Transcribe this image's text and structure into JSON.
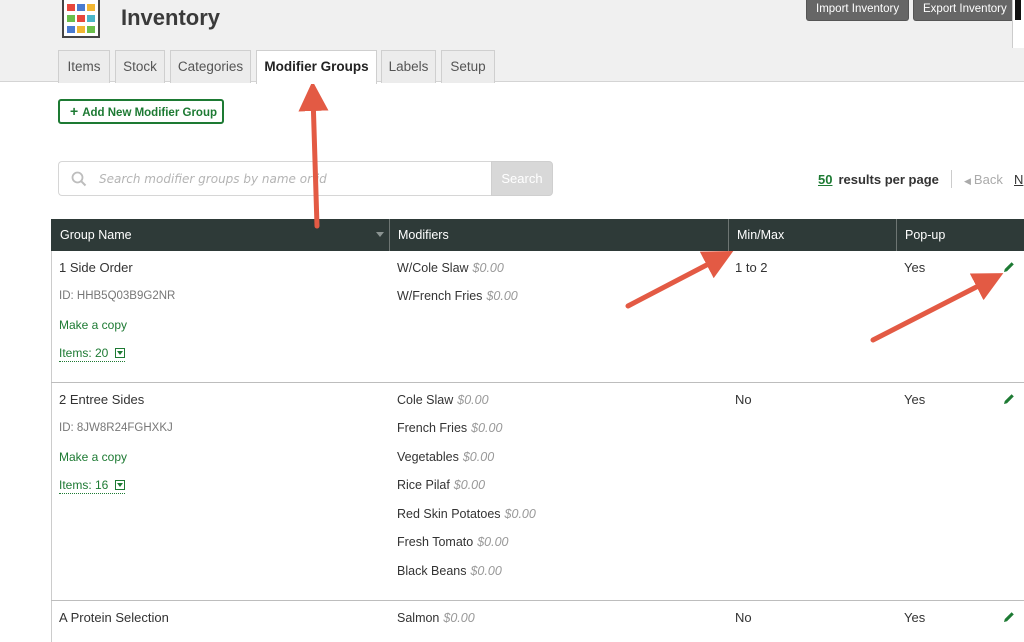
{
  "header": {
    "title": "Inventory",
    "import_label": "Import Inventory",
    "export_label": "Export Inventory"
  },
  "tabs": [
    {
      "label": "Items",
      "active": false
    },
    {
      "label": "Stock",
      "active": false
    },
    {
      "label": "Categories",
      "active": false
    },
    {
      "label": "Modifier Groups",
      "active": true
    },
    {
      "label": "Labels",
      "active": false
    },
    {
      "label": "Setup",
      "active": false
    }
  ],
  "toolbar": {
    "add_label": "Add New Modifier Group",
    "search_placeholder": "Search modifier groups by name or id",
    "search_button": "Search"
  },
  "pagination": {
    "per_page": "50",
    "per_page_label": "results per page",
    "back_label": "Back",
    "next_label": "N"
  },
  "table": {
    "columns": [
      "Group Name",
      "Modifiers",
      "Min/Max",
      "Pop-up"
    ],
    "rows": [
      {
        "name": "1 Side Order",
        "id": "ID: HHB5Q03B9G2NR",
        "copy_label": "Make a copy",
        "items_label": "Items: 20",
        "modifiers": [
          {
            "name": "W/Cole Slaw",
            "price": "$0.00"
          },
          {
            "name": "W/French Fries",
            "price": "$0.00"
          }
        ],
        "minmax": "1 to 2",
        "popup": "Yes"
      },
      {
        "name": "2 Entree Sides",
        "id": "ID: 8JW8R24FGHXKJ",
        "copy_label": "Make a copy",
        "items_label": "Items: 16",
        "modifiers": [
          {
            "name": "Cole Slaw",
            "price": "$0.00"
          },
          {
            "name": "French Fries",
            "price": "$0.00"
          },
          {
            "name": "Vegetables",
            "price": "$0.00"
          },
          {
            "name": "Rice Pilaf",
            "price": "$0.00"
          },
          {
            "name": "Red Skin Potatoes",
            "price": "$0.00"
          },
          {
            "name": "Fresh Tomato",
            "price": "$0.00"
          },
          {
            "name": "Black Beans",
            "price": "$0.00"
          }
        ],
        "minmax": "No",
        "popup": "Yes"
      },
      {
        "name": "A Protein Selection",
        "modifiers": [
          {
            "name": "Salmon",
            "price": "$0.00"
          }
        ],
        "minmax": "No",
        "popup": "Yes"
      }
    ]
  },
  "icons": {
    "edit": "pencil-icon",
    "search": "search-icon",
    "add": "plus-icon",
    "expand": "caret-down-icon",
    "back": "triangle-left-icon"
  },
  "colors": {
    "accent_green": "#1d7a33",
    "header_dark": "#2e3a38",
    "annotation_red": "#e35a44"
  }
}
